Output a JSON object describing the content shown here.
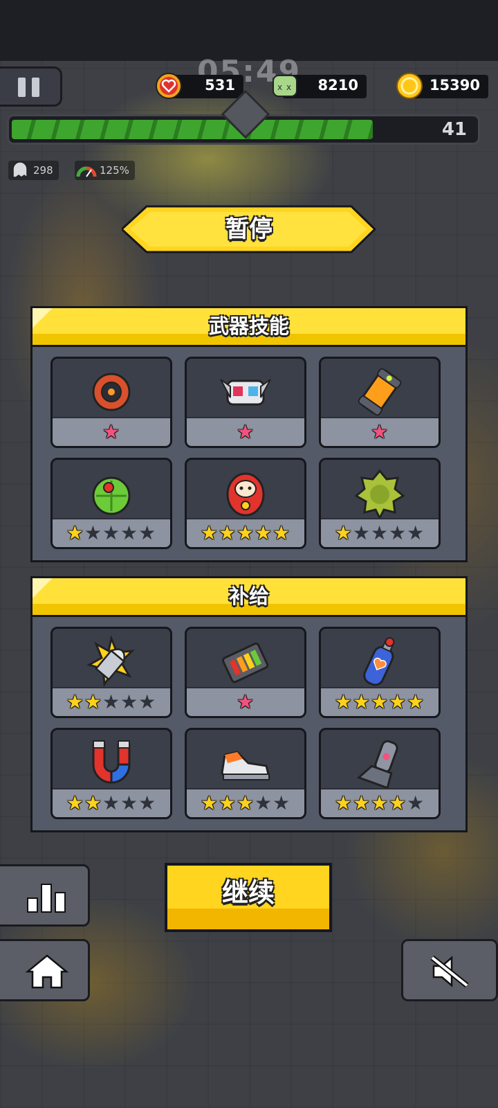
{
  "hud": {
    "timer": "05:49",
    "hearts": "531",
    "kills": "8210",
    "coins": "15390",
    "level": "41",
    "xp_progress": 0.87,
    "enemy_count": "298",
    "speed": "125%"
  },
  "pause": {
    "title": "暂停",
    "weapons_title": "武器技能",
    "supplies_title": "补给",
    "continue_label": "继续"
  },
  "weapons": [
    {
      "icon": "flame-wheel-icon",
      "stars": 1,
      "max": 1
    },
    {
      "icon": "drone-robot-icon",
      "stars": 1,
      "max": 1
    },
    {
      "icon": "energy-canister-icon",
      "stars": 1,
      "max": 1
    },
    {
      "icon": "green-disc-icon",
      "stars": 1,
      "max": 5
    },
    {
      "icon": "daruma-icon",
      "stars": 5,
      "max": 5
    },
    {
      "icon": "durian-icon",
      "stars": 1,
      "max": 5
    }
  ],
  "supplies": [
    {
      "icon": "bullet-icon",
      "stars": 2,
      "max": 5
    },
    {
      "icon": "battery-icon",
      "stars": 1,
      "max": 1
    },
    {
      "icon": "oxygen-tank-icon",
      "stars": 5,
      "max": 5
    },
    {
      "icon": "magnet-icon",
      "stars": 2,
      "max": 5
    },
    {
      "icon": "sneaker-icon",
      "stars": 3,
      "max": 5
    },
    {
      "icon": "armor-leg-icon",
      "stars": 4,
      "max": 5
    }
  ],
  "colors": {
    "accent_yellow": "#ffd51f",
    "star_yellow": "#ffd21a",
    "star_pink": "#f1527e",
    "xp_green": "#3ea62e"
  }
}
